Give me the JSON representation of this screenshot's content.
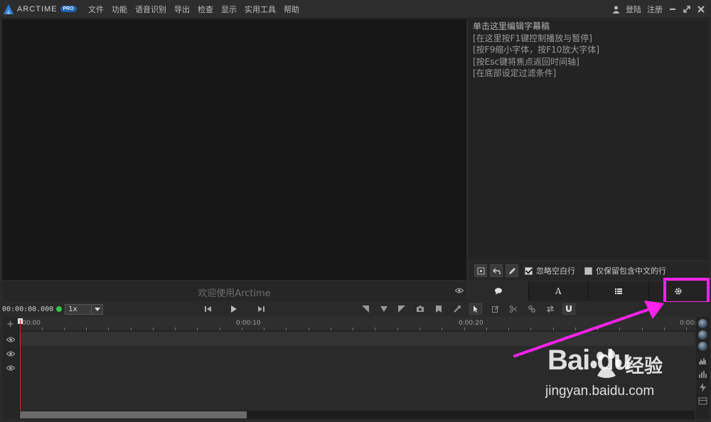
{
  "app": {
    "brand": "ARCTIME",
    "badge": "PRO"
  },
  "menu": [
    "文件",
    "功能",
    "语音识别",
    "导出",
    "检查",
    "显示",
    "实用工具",
    "帮助"
  ],
  "topright": {
    "login": "登陆",
    "register": "注册"
  },
  "video": {
    "welcome": "欢迎使用Arctime"
  },
  "subtitle_panel": {
    "lines": [
      "单击这里编辑字幕稿",
      "[在这里按F1键控制播放与暂停]",
      "[按F9缩小字体，按F10放大字体]",
      "[按Esc键将焦点返回时间轴]",
      "[在底部设定过滤条件]"
    ]
  },
  "filters": {
    "ignore_blank": "忽略空白行",
    "ignore_blank_checked": true,
    "keep_chinese": "仅保留包含中文的行",
    "keep_chinese_checked": false
  },
  "tabs": {
    "style_label": "A"
  },
  "transport": {
    "timecode": "00:00:00.000",
    "speed": "1x"
  },
  "timeline": {
    "ruler_labels": [
      "00:00",
      "0:00:10",
      "0:00:20",
      "0:00:"
    ]
  },
  "watermark": {
    "brand": "Bai du",
    "product": "经验",
    "url": "jingyan.baidu.com"
  },
  "colors": {
    "highlight": "#ff22ee",
    "accent": "#1f64b3",
    "status_dot": "#35c34a",
    "playhead": "#d02020"
  },
  "icons": [
    "arctime-logo-icon",
    "user-icon",
    "minimize-icon",
    "maximize-icon",
    "close-icon",
    "eye-icon",
    "add-icon",
    "undo-icon",
    "edit-icon",
    "chat-icon",
    "text-style-icon",
    "list-icon",
    "gear-icon",
    "skip-back-icon",
    "play-icon",
    "skip-forward-icon",
    "camera-icon",
    "bookmark-icon",
    "cursor-icon",
    "scissors-icon",
    "link-icon",
    "swap-icon",
    "magnet-icon"
  ]
}
